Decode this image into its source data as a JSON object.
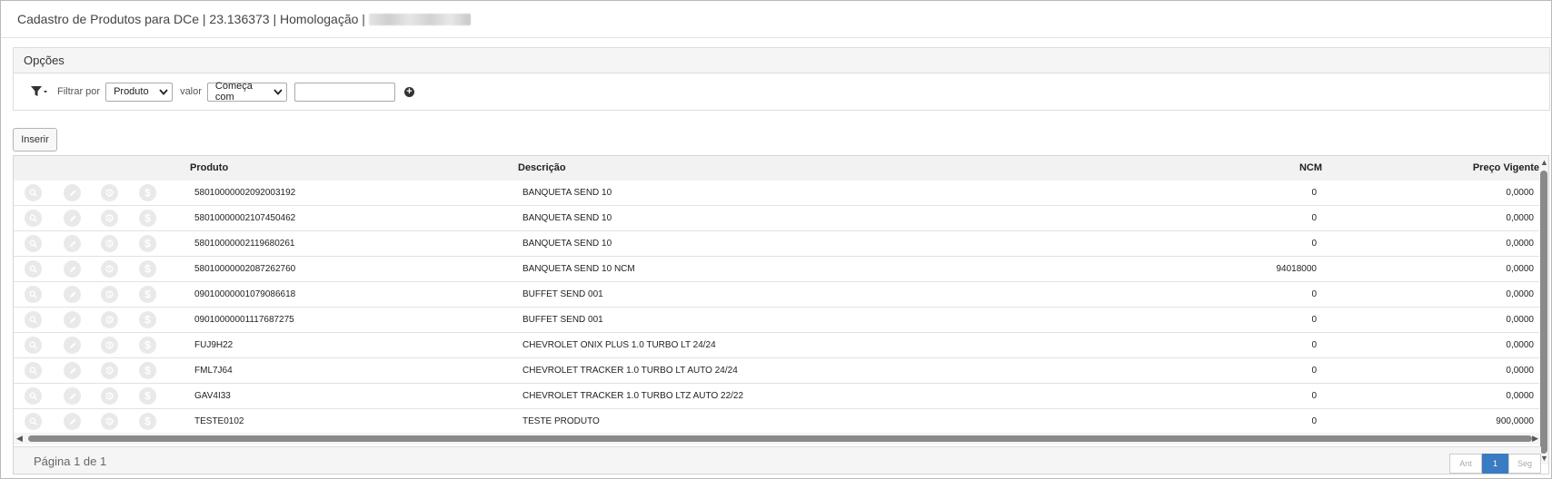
{
  "window": {
    "title": "Cadastro de Produtos para DCe | 23.136373 | Homologação |"
  },
  "options": {
    "header": "Opções",
    "filter_label": "Filtrar por",
    "filter_field": "Produto",
    "value_label": "valor",
    "match_mode": "Começa com",
    "search_value": ""
  },
  "actions": {
    "insert_label": "Inserir"
  },
  "table": {
    "columns": [
      "Produto",
      "Descrição",
      "NCM",
      "Preço Vigente"
    ],
    "rows": [
      {
        "produto": "58010000002092003192",
        "descricao": "BANQUETA SEND 10",
        "ncm": "0",
        "preco": "0,0000"
      },
      {
        "produto": "58010000002107450462",
        "descricao": "BANQUETA SEND 10",
        "ncm": "0",
        "preco": "0,0000"
      },
      {
        "produto": "58010000002119680261",
        "descricao": "BANQUETA SEND 10",
        "ncm": "0",
        "preco": "0,0000"
      },
      {
        "produto": "58010000002087262760",
        "descricao": "BANQUETA SEND 10 NCM",
        "ncm": "94018000",
        "preco": "0,0000"
      },
      {
        "produto": "09010000001079086618",
        "descricao": "BUFFET SEND 001",
        "ncm": "0",
        "preco": "0,0000"
      },
      {
        "produto": "09010000001117687275",
        "descricao": "BUFFET SEND 001",
        "ncm": "0",
        "preco": "0,0000"
      },
      {
        "produto": "FUJ9H22",
        "descricao": "CHEVROLET ONIX PLUS 1.0 TURBO LT 24/24",
        "ncm": "0",
        "preco": "0,0000"
      },
      {
        "produto": "FML7J64",
        "descricao": "CHEVROLET TRACKER 1.0 TURBO LT AUTO 24/24",
        "ncm": "0",
        "preco": "0,0000"
      },
      {
        "produto": "GAV4I33",
        "descricao": "CHEVROLET TRACKER 1.0 TURBO LTZ AUTO 22/22",
        "ncm": "0",
        "preco": "0,0000"
      },
      {
        "produto": "TESTE0102",
        "descricao": "TESTE PRODUTO",
        "ncm": "0",
        "preco": "900,0000"
      }
    ],
    "row_action_icons": [
      "search-icon",
      "edit-icon",
      "history-icon",
      "price-icon"
    ]
  },
  "pagination": {
    "info": "Página 1 de 1",
    "prev": "Ant",
    "current": "1",
    "next": "Seg"
  },
  "colors": {
    "accent": "#3a7cc1",
    "header_bg": "#f2f2f2",
    "icon_disabled": "#e9e9e9"
  }
}
